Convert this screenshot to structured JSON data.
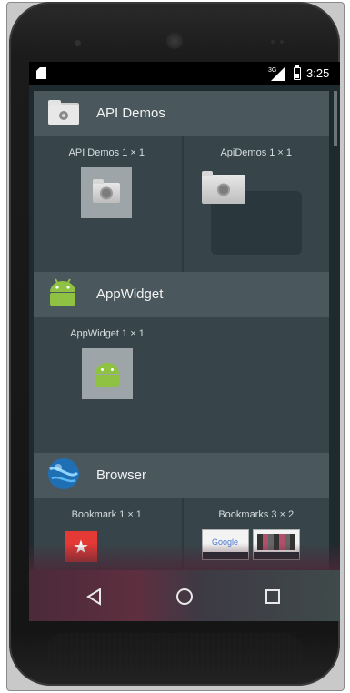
{
  "status_bar": {
    "network_label": "3G",
    "time": "3:25"
  },
  "groups": [
    {
      "title": "API Demos",
      "icon": "folder-gear-icon",
      "widgets": [
        {
          "label": "API Demos 1 × 1",
          "preview": "folder-gear-icon"
        },
        {
          "label": "ApiDemos 1 × 1",
          "preview": "folder-gear-large-icon"
        }
      ]
    },
    {
      "title": "AppWidget",
      "icon": "android-icon",
      "widgets": [
        {
          "label": "AppWidget 1 × 1",
          "preview": "android-icon"
        }
      ]
    },
    {
      "title": "Browser",
      "icon": "globe-icon",
      "widgets": [
        {
          "label": "Bookmark 1 × 1",
          "preview": "bookmark-star-icon"
        },
        {
          "label": "Bookmarks 3 × 2",
          "preview": "bookmarks-thumbnails"
        }
      ]
    }
  ],
  "nav": {
    "back_icon": "back-triangle-icon",
    "home_icon": "home-circle-icon",
    "recents_icon": "recents-square-icon"
  },
  "thumbnail_text": {
    "google": "Google"
  },
  "colors": {
    "header_bg": "#4a585e",
    "body_bg": "#37454b",
    "android_green": "#8fc142",
    "bookmark_red": "#e53935"
  }
}
